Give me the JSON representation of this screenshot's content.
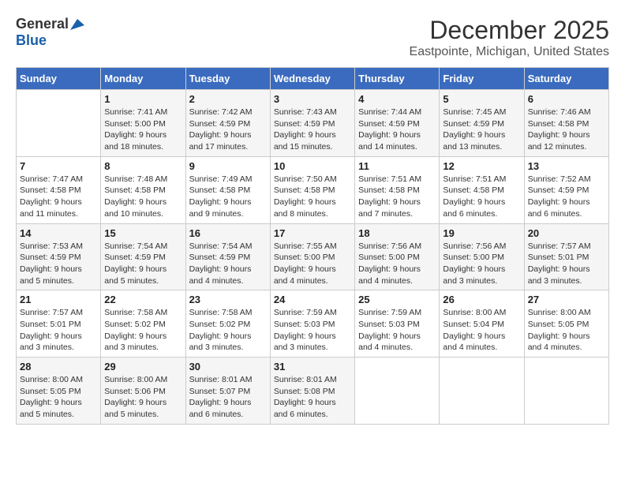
{
  "logo": {
    "general": "General",
    "blue": "Blue"
  },
  "title": "December 2025",
  "location": "Eastpointe, Michigan, United States",
  "days_of_week": [
    "Sunday",
    "Monday",
    "Tuesday",
    "Wednesday",
    "Thursday",
    "Friday",
    "Saturday"
  ],
  "weeks": [
    [
      {
        "day": "",
        "info": ""
      },
      {
        "day": "1",
        "info": "Sunrise: 7:41 AM\nSunset: 5:00 PM\nDaylight: 9 hours\nand 18 minutes."
      },
      {
        "day": "2",
        "info": "Sunrise: 7:42 AM\nSunset: 4:59 PM\nDaylight: 9 hours\nand 17 minutes."
      },
      {
        "day": "3",
        "info": "Sunrise: 7:43 AM\nSunset: 4:59 PM\nDaylight: 9 hours\nand 15 minutes."
      },
      {
        "day": "4",
        "info": "Sunrise: 7:44 AM\nSunset: 4:59 PM\nDaylight: 9 hours\nand 14 minutes."
      },
      {
        "day": "5",
        "info": "Sunrise: 7:45 AM\nSunset: 4:59 PM\nDaylight: 9 hours\nand 13 minutes."
      },
      {
        "day": "6",
        "info": "Sunrise: 7:46 AM\nSunset: 4:58 PM\nDaylight: 9 hours\nand 12 minutes."
      }
    ],
    [
      {
        "day": "7",
        "info": "Sunrise: 7:47 AM\nSunset: 4:58 PM\nDaylight: 9 hours\nand 11 minutes."
      },
      {
        "day": "8",
        "info": "Sunrise: 7:48 AM\nSunset: 4:58 PM\nDaylight: 9 hours\nand 10 minutes."
      },
      {
        "day": "9",
        "info": "Sunrise: 7:49 AM\nSunset: 4:58 PM\nDaylight: 9 hours\nand 9 minutes."
      },
      {
        "day": "10",
        "info": "Sunrise: 7:50 AM\nSunset: 4:58 PM\nDaylight: 9 hours\nand 8 minutes."
      },
      {
        "day": "11",
        "info": "Sunrise: 7:51 AM\nSunset: 4:58 PM\nDaylight: 9 hours\nand 7 minutes."
      },
      {
        "day": "12",
        "info": "Sunrise: 7:51 AM\nSunset: 4:58 PM\nDaylight: 9 hours\nand 6 minutes."
      },
      {
        "day": "13",
        "info": "Sunrise: 7:52 AM\nSunset: 4:59 PM\nDaylight: 9 hours\nand 6 minutes."
      }
    ],
    [
      {
        "day": "14",
        "info": "Sunrise: 7:53 AM\nSunset: 4:59 PM\nDaylight: 9 hours\nand 5 minutes."
      },
      {
        "day": "15",
        "info": "Sunrise: 7:54 AM\nSunset: 4:59 PM\nDaylight: 9 hours\nand 5 minutes."
      },
      {
        "day": "16",
        "info": "Sunrise: 7:54 AM\nSunset: 4:59 PM\nDaylight: 9 hours\nand 4 minutes."
      },
      {
        "day": "17",
        "info": "Sunrise: 7:55 AM\nSunset: 5:00 PM\nDaylight: 9 hours\nand 4 minutes."
      },
      {
        "day": "18",
        "info": "Sunrise: 7:56 AM\nSunset: 5:00 PM\nDaylight: 9 hours\nand 4 minutes."
      },
      {
        "day": "19",
        "info": "Sunrise: 7:56 AM\nSunset: 5:00 PM\nDaylight: 9 hours\nand 3 minutes."
      },
      {
        "day": "20",
        "info": "Sunrise: 7:57 AM\nSunset: 5:01 PM\nDaylight: 9 hours\nand 3 minutes."
      }
    ],
    [
      {
        "day": "21",
        "info": "Sunrise: 7:57 AM\nSunset: 5:01 PM\nDaylight: 9 hours\nand 3 minutes."
      },
      {
        "day": "22",
        "info": "Sunrise: 7:58 AM\nSunset: 5:02 PM\nDaylight: 9 hours\nand 3 minutes."
      },
      {
        "day": "23",
        "info": "Sunrise: 7:58 AM\nSunset: 5:02 PM\nDaylight: 9 hours\nand 3 minutes."
      },
      {
        "day": "24",
        "info": "Sunrise: 7:59 AM\nSunset: 5:03 PM\nDaylight: 9 hours\nand 3 minutes."
      },
      {
        "day": "25",
        "info": "Sunrise: 7:59 AM\nSunset: 5:03 PM\nDaylight: 9 hours\nand 4 minutes."
      },
      {
        "day": "26",
        "info": "Sunrise: 8:00 AM\nSunset: 5:04 PM\nDaylight: 9 hours\nand 4 minutes."
      },
      {
        "day": "27",
        "info": "Sunrise: 8:00 AM\nSunset: 5:05 PM\nDaylight: 9 hours\nand 4 minutes."
      }
    ],
    [
      {
        "day": "28",
        "info": "Sunrise: 8:00 AM\nSunset: 5:05 PM\nDaylight: 9 hours\nand 5 minutes."
      },
      {
        "day": "29",
        "info": "Sunrise: 8:00 AM\nSunset: 5:06 PM\nDaylight: 9 hours\nand 5 minutes."
      },
      {
        "day": "30",
        "info": "Sunrise: 8:01 AM\nSunset: 5:07 PM\nDaylight: 9 hours\nand 6 minutes."
      },
      {
        "day": "31",
        "info": "Sunrise: 8:01 AM\nSunset: 5:08 PM\nDaylight: 9 hours\nand 6 minutes."
      },
      {
        "day": "",
        "info": ""
      },
      {
        "day": "",
        "info": ""
      },
      {
        "day": "",
        "info": ""
      }
    ]
  ]
}
